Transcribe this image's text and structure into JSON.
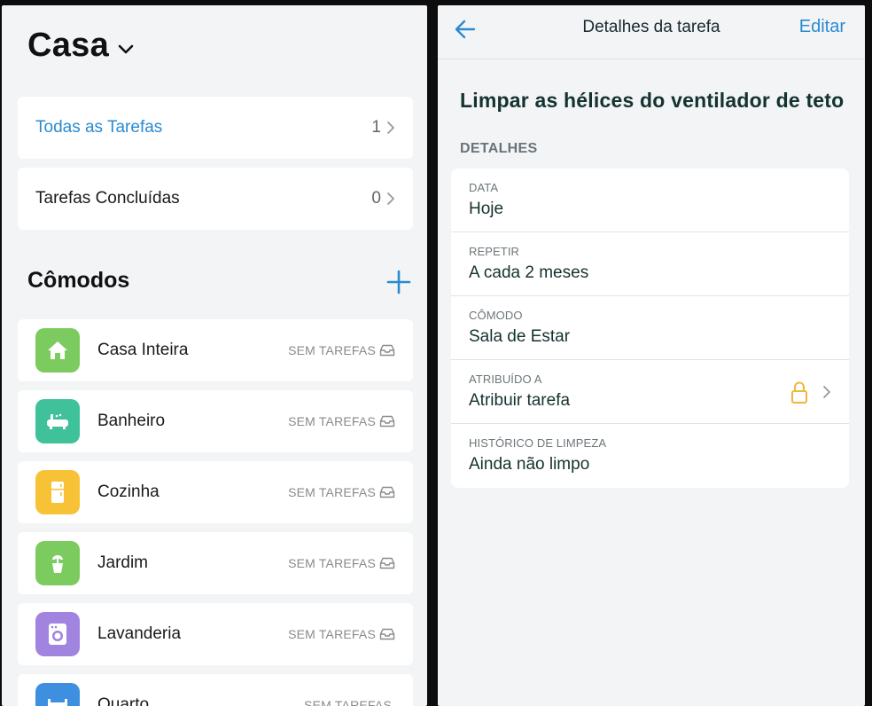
{
  "home": {
    "title": "Casa",
    "all_tasks": {
      "label": "Todas as Tarefas",
      "count": "1"
    },
    "done_tasks": {
      "label": "Tarefas Concluídas",
      "count": "0"
    },
    "rooms_title": "Cômodos",
    "rooms": [
      {
        "name": "Casa Inteira",
        "status": "SEM TAREFAS",
        "icon": "house-icon",
        "color": "#7ccb5e"
      },
      {
        "name": "Banheiro",
        "status": "SEM TAREFAS",
        "icon": "bathtub-icon",
        "color": "#3fc19a"
      },
      {
        "name": "Cozinha",
        "status": "SEM TAREFAS",
        "icon": "fridge-icon",
        "color": "#f7c236"
      },
      {
        "name": "Jardim",
        "status": "SEM TAREFAS",
        "icon": "plant-icon",
        "color": "#7ccb5e"
      },
      {
        "name": "Lavanderia",
        "status": "SEM TAREFAS",
        "icon": "washing-machine-icon",
        "color": "#a184e0"
      },
      {
        "name": "Quarto",
        "status": "SEM TAREFAS",
        "icon": "bed-icon",
        "color": "#3e8fe0"
      }
    ]
  },
  "detail": {
    "header_title": "Detalhes da tarefa",
    "edit_label": "Editar",
    "task_title": "Limpar as hélices do ventilador de teto",
    "section_label": "DETALHES",
    "rows": [
      {
        "label": "DATA",
        "value": "Hoje"
      },
      {
        "label": "REPETIR",
        "value": "A cada 2 meses"
      },
      {
        "label": "CÔMODO",
        "value": "Sala de Estar"
      },
      {
        "label": "ATRIBUÍDO A",
        "value": "Atribuir tarefa"
      },
      {
        "label": "HISTÓRICO DE LIMPEZA",
        "value": "Ainda não limpo"
      }
    ]
  },
  "colors": {
    "accent": "#2a8bd0",
    "lock": "#f0b73a"
  }
}
